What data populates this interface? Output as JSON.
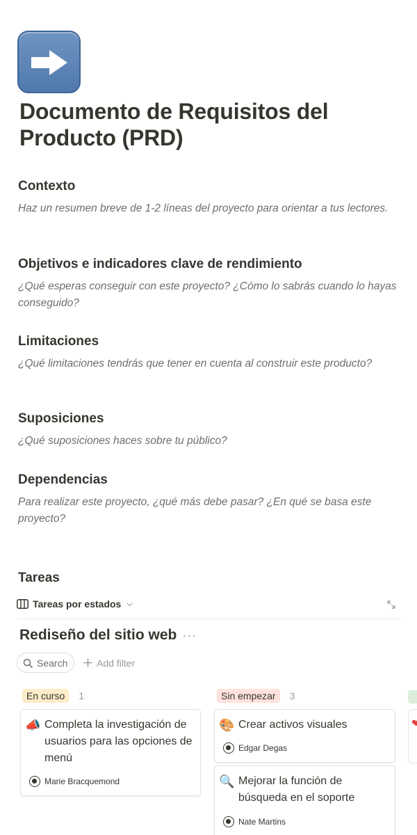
{
  "page": {
    "icon": "right-arrow-icon",
    "title": "Documento de Requisitos del Producto (PRD)"
  },
  "sections": [
    {
      "heading": "Contexto",
      "text": "Haz un resumen breve de 1-2 líneas del proyecto para orientar a tus lectores."
    },
    {
      "heading": "Objetivos e indicadores clave de rendimiento",
      "text": "¿Qué esperas conseguir con este proyecto? ¿Cómo lo sabrás cuando lo hayas conseguido?"
    },
    {
      "heading": "Limitaciones",
      "text": "¿Qué limitaciones tendrás que tener en cuenta al construir este producto?"
    },
    {
      "heading": "Suposiciones",
      "text": "¿Qué suposiciones haces sobre tu público?"
    },
    {
      "heading": "Dependencias",
      "text": "Para realizar este proyecto, ¿qué más debe pasar? ¿En qué se basa este proyecto?"
    }
  ],
  "tasks": {
    "heading": "Tareas",
    "view_label": "Tareas por estados",
    "board_title": "Rediseño del sitio web",
    "more_label": "···",
    "search_label": "Search",
    "add_filter_label": "Add filter",
    "columns": [
      {
        "status": "En curso",
        "count": "1",
        "color": "#fdecc8",
        "cards": [
          {
            "emoji": "📣",
            "name": "Completa la investigación de usuarios para las opciones de menú",
            "person": "Marie Bracquemond"
          }
        ]
      },
      {
        "status": "Sin empezar",
        "count": "3",
        "color": "#ffe2dd",
        "cards": [
          {
            "emoji": "🎨",
            "name": "Crear activos visuales",
            "person": "Edgar Degas"
          },
          {
            "emoji": "🔍",
            "name": "Mejorar la función de búsqueda en el soporte",
            "person": "Nate Martins"
          }
        ]
      }
    ]
  }
}
